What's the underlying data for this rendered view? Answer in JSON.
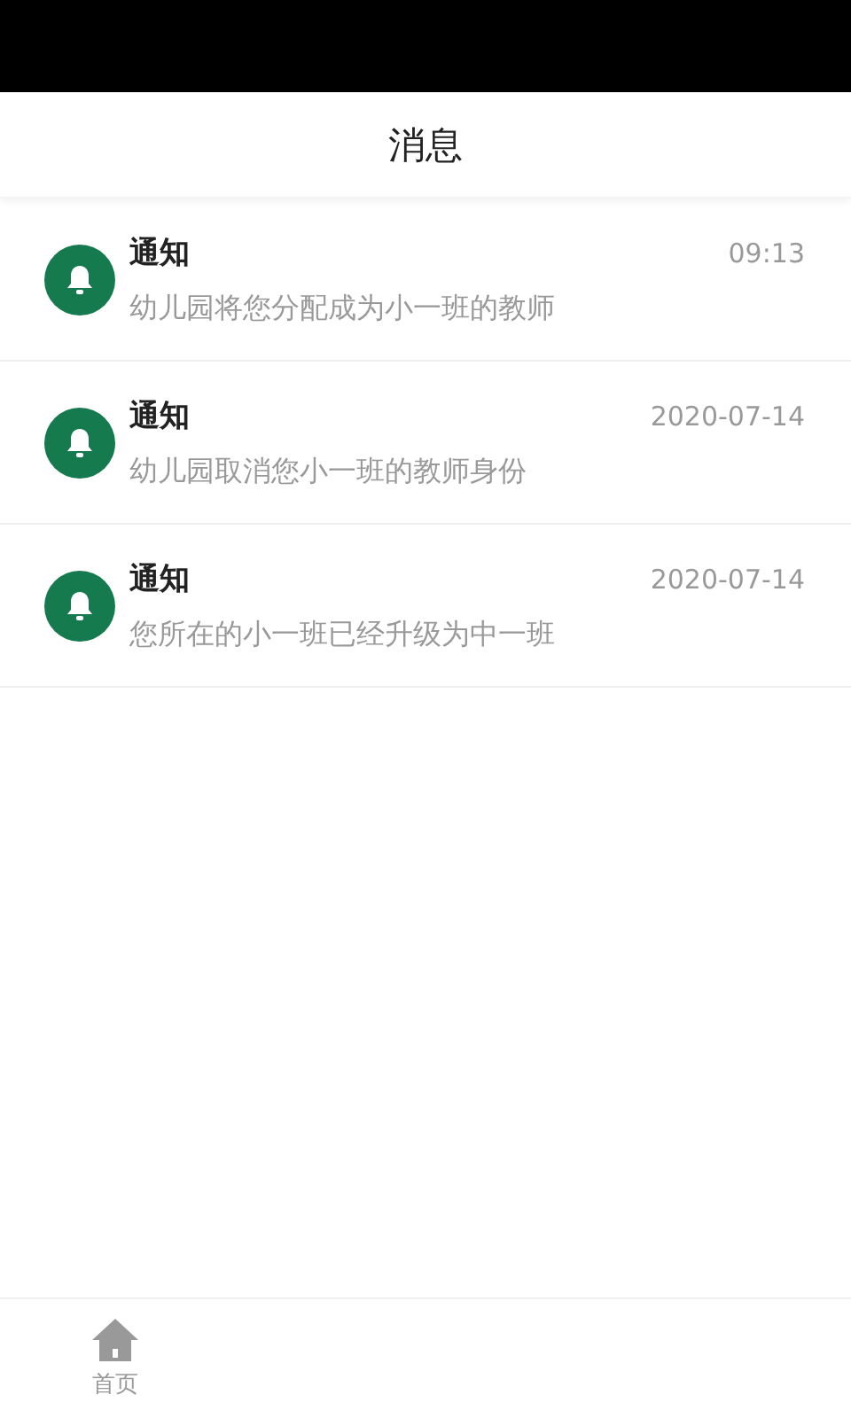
{
  "header": {
    "title": "消息"
  },
  "messages": [
    {
      "title": "通知",
      "time": "09:13",
      "text": "幼儿园将您分配成为小一班的教师"
    },
    {
      "title": "通知",
      "time": "2020-07-14",
      "text": "幼儿园取消您小一班的教师身份"
    },
    {
      "title": "通知",
      "time": "2020-07-14",
      "text": "您所在的小一班已经升级为中一班"
    }
  ],
  "tab_bar": [
    {
      "label": "首页",
      "selected": false
    }
  ]
}
